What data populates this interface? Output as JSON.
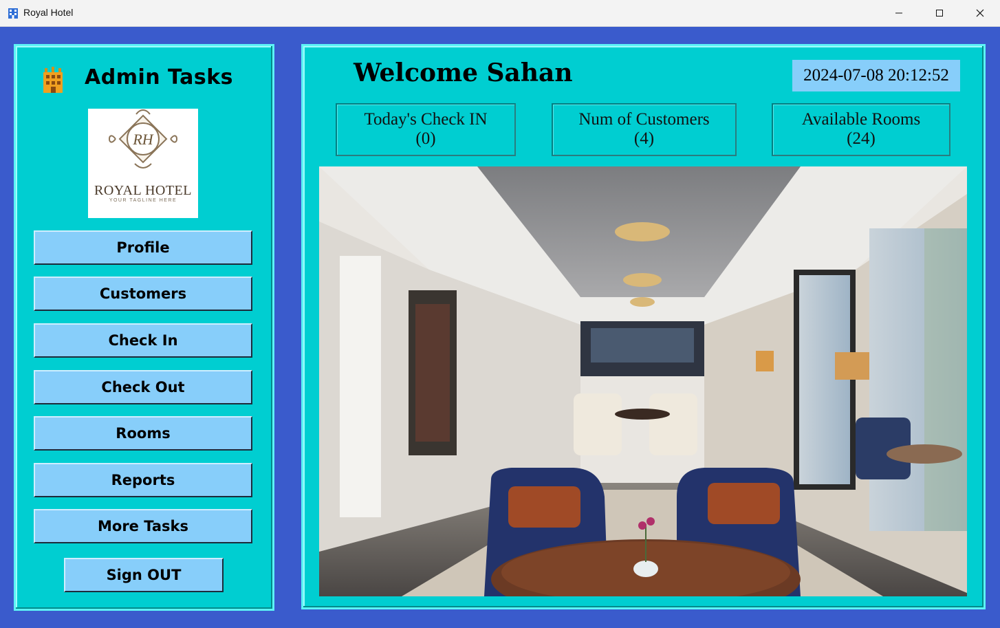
{
  "window": {
    "title": "Royal Hotel"
  },
  "sidebar": {
    "heading": "Admin Tasks",
    "logo": {
      "line1": "ROYAL HOTEL",
      "line2": "YOUR TAGLINE HERE",
      "monogram": "RH"
    },
    "buttons": [
      "Profile",
      "Customers",
      "Check In",
      "Check Out",
      "Rooms",
      "Reports",
      "More Tasks"
    ],
    "signout": "Sign OUT"
  },
  "main": {
    "welcome": "Welcome Sahan",
    "datetime": "2024-07-08 20:12:52",
    "stats": [
      {
        "label": "Today's Check IN",
        "value": "(0)"
      },
      {
        "label": "Num of Customers",
        "value": "(4)"
      },
      {
        "label": "Available Rooms",
        "value": "(24)"
      }
    ]
  },
  "colors": {
    "background": "#3a5bcc",
    "panel": "#00ced1",
    "button": "#87cefa"
  }
}
